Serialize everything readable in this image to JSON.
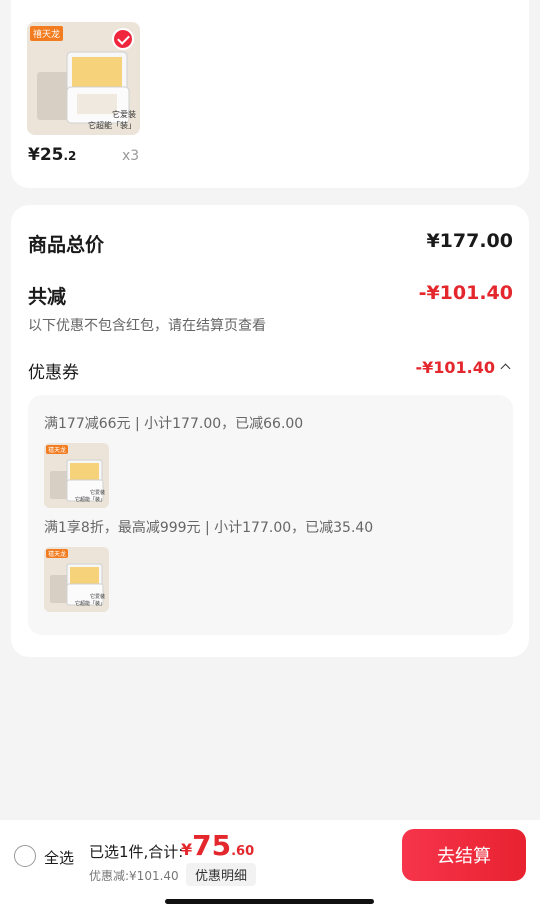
{
  "product": {
    "brand_tag": "禧天龙",
    "caption_line1": "它爱装",
    "caption_line2": "它超能「装」",
    "price_yen": "¥25",
    "price_decimal": ".2",
    "quantity": "x3"
  },
  "summary": {
    "total_label": "商品总价",
    "total_value": "¥177.00",
    "reduction_label": "共减",
    "reduction_value": "-¥101.40",
    "reduction_note": "以下优惠不包含红包，请在结算页查看",
    "coupon_label": "优惠券",
    "coupon_value": "-¥101.40"
  },
  "coupon_details": [
    {
      "text": "满177减66元 | 小计177.00，已减66.00",
      "brand_tag": "禧天龙",
      "caption_line1": "它爱装",
      "caption_line2": "它超能「装」"
    },
    {
      "text": "满1享8折，最高减999元 | 小计177.00，已减35.40",
      "brand_tag": "禧天龙",
      "caption_line1": "它爱装",
      "caption_line2": "它超能「装」"
    }
  ],
  "bottom_bar": {
    "select_all": "全选",
    "selected_info": "已选1件,合计:",
    "yen": "¥",
    "total_int": "75",
    "total_dec": ".60",
    "discount_info": "优惠减:¥101.40",
    "details_chip": "优惠明细",
    "checkout": "去结算"
  },
  "colors": {
    "accent_red": "#e4262d",
    "checkout_gradient_start": "#f6344b",
    "checkout_gradient_end": "#e8222f",
    "background": "#f4f4f4",
    "card": "#ffffff"
  },
  "icons": [
    "check-badge-icon",
    "chevron-up-icon",
    "radio-circle-icon"
  ]
}
